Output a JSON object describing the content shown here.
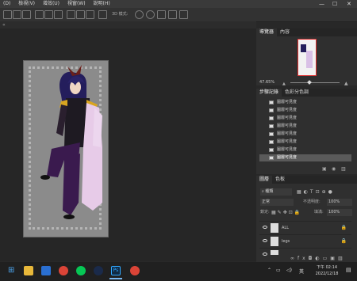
{
  "menubar": {
    "items": [
      "(D)",
      "檢視(V)",
      "增效(U)",
      "視窗(W)",
      "說明(H)"
    ]
  },
  "options_bar": {
    "mode_label": "3D 模式:"
  },
  "navigator": {
    "tabs": [
      "導覽器",
      "內容"
    ],
    "zoom": "47.65%"
  },
  "history": {
    "tabs": [
      "步驟記錄",
      "色彩分色調"
    ],
    "items": [
      "圖層可見度",
      "圖層可見度",
      "圖層可見度",
      "圖層可見度",
      "圖層可見度",
      "圖層可見度",
      "圖層可見度",
      "圖層可見度"
    ]
  },
  "layers": {
    "tabs": [
      "圖層",
      "色板"
    ],
    "kind_label": "種類",
    "blend_mode": "正常",
    "opacity_label": "不透明度:",
    "opacity_value": "100%",
    "lock_label": "鎖定:",
    "fill_label": "填滿:",
    "fill_value": "100%",
    "items": [
      {
        "name": "ALL"
      },
      {
        "name": "legs"
      },
      {
        "name": ""
      }
    ]
  },
  "taskbar": {
    "ime": "英",
    "time": "下午 02:14",
    "date": "2022/12/18"
  },
  "colors": {
    "accent": "#e03030",
    "hair": "#241e5c",
    "coat_pink": "#e7cbe8",
    "suit_purple": "#3a1a4e",
    "gold": "#d9a520"
  }
}
